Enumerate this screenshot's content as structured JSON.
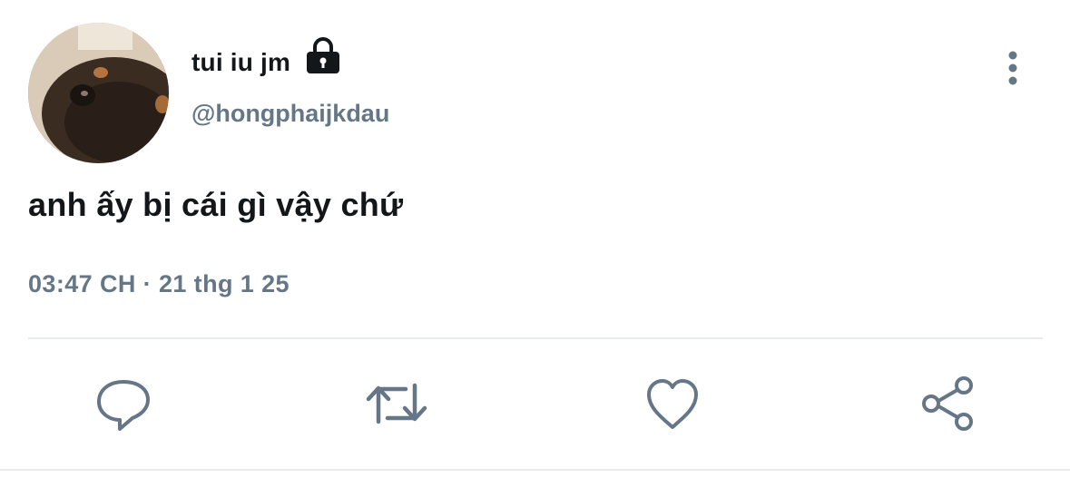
{
  "user": {
    "display_name": "tui iu jm",
    "handle": "@hongphaijkdau",
    "protected_icon": "lock-icon",
    "avatar": "profile-photo"
  },
  "tweet": {
    "text": "anh ấy bị cái gì vậy chứ",
    "timestamp": "03:47 CH · 21 thg 1 25"
  },
  "menu": {
    "icon": "more-vertical-icon"
  },
  "actions": [
    {
      "name": "reply",
      "icon": "comment-icon"
    },
    {
      "name": "retweet",
      "icon": "retweet-icon"
    },
    {
      "name": "like",
      "icon": "heart-icon"
    },
    {
      "name": "share",
      "icon": "share-icon"
    }
  ],
  "colors": {
    "text_primary": "#14171a",
    "text_secondary": "#657786",
    "icon": "#657786",
    "divider": "#e6ecf0"
  }
}
